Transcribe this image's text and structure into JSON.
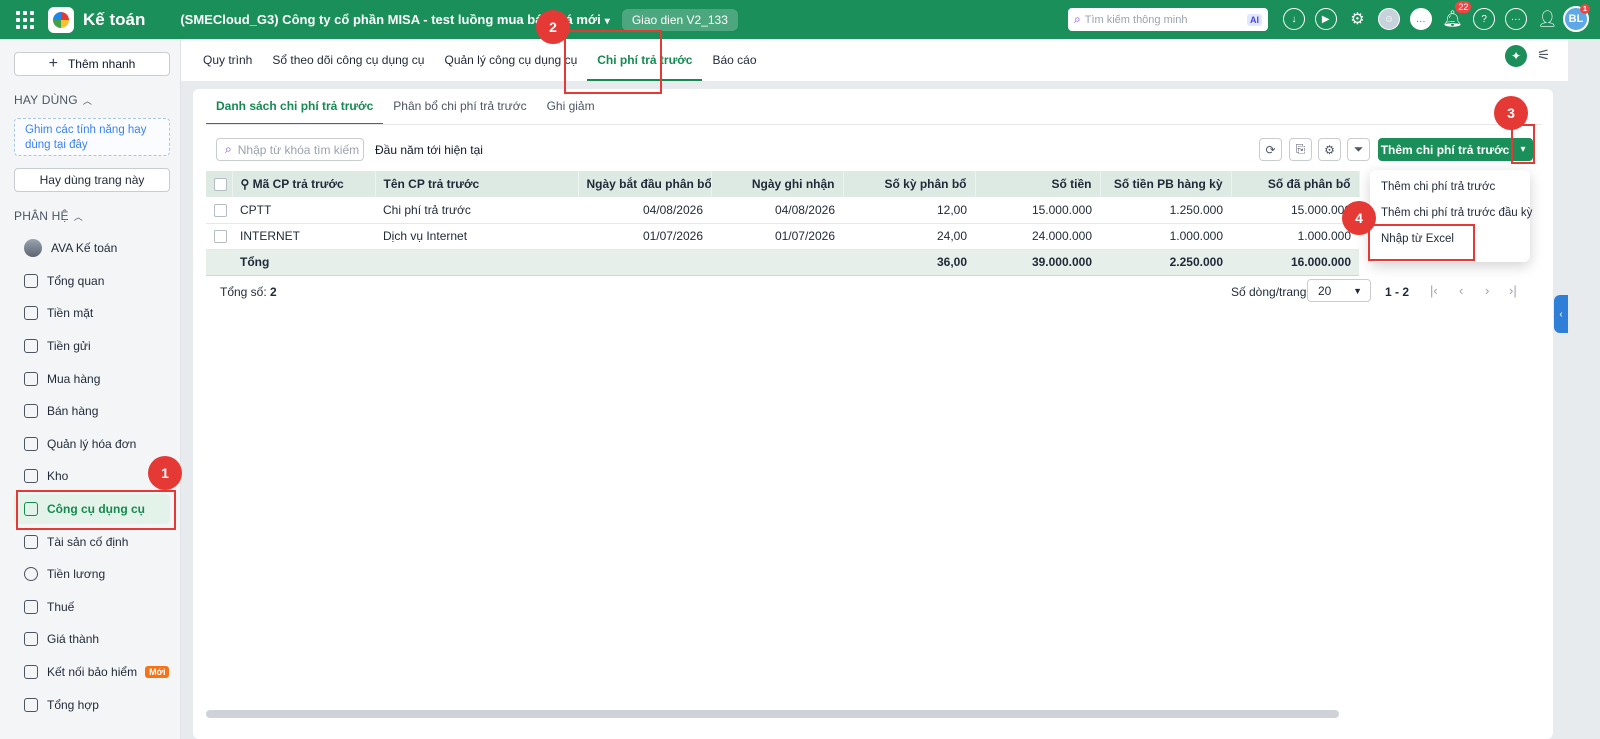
{
  "topbar": {
    "app_name": "Kế toán",
    "company": "(SMECloud_G3) Công ty cổ phần MISA - test luồng mua báo giá mới",
    "version": "Giao dien V2_133",
    "search_placeholder": "Tìm kiếm thông minh",
    "ai_label": "AI",
    "notification_count": "22",
    "user_initials": "BL",
    "user_badge": "1"
  },
  "sidebar": {
    "quick_add": "Thêm nhanh",
    "favorites_title": "HAY DÙNG",
    "pin_hint": "Ghim các tính năng hay dùng tại đây",
    "use_page_button": "Hay dùng trang này",
    "modules_title": "PHÂN HỆ",
    "items": [
      {
        "label": "AVA Kế toán"
      },
      {
        "label": "Tổng quan"
      },
      {
        "label": "Tiền mặt"
      },
      {
        "label": "Tiền gửi"
      },
      {
        "label": "Mua hàng"
      },
      {
        "label": "Bán hàng"
      },
      {
        "label": "Quản lý hóa đơn"
      },
      {
        "label": "Kho"
      },
      {
        "label": "Công cụ dụng cụ"
      },
      {
        "label": "Tài sản cố định"
      },
      {
        "label": "Tiền lương"
      },
      {
        "label": "Thuế"
      },
      {
        "label": "Giá thành"
      },
      {
        "label": "Kết nối bảo hiểm",
        "badge": "Mới"
      },
      {
        "label": "Tổng hợp"
      }
    ]
  },
  "main_tabs": [
    "Quy trình",
    "Sổ theo dõi công cụ dụng cụ",
    "Quản lý công cụ dụng cụ",
    "Chi phí trả trước",
    "Báo cáo"
  ],
  "sub_tabs": [
    "Danh sách chi phí trả trước",
    "Phân bổ chi phí trả trước",
    "Ghi giảm"
  ],
  "toolbar": {
    "search_placeholder": "Nhập từ khóa tìm kiếm",
    "period": "Đầu năm tới hiện tại",
    "primary_button": "Thêm chi phí trả trước"
  },
  "table": {
    "headers": [
      "Mã CP trả trước",
      "Tên CP trả trước",
      "Ngày bắt đầu phân bổ",
      "Ngày ghi nhận",
      "Số kỳ phân bổ",
      "Số tiền",
      "Số tiền PB hàng kỳ",
      "Số đã phân bổ"
    ],
    "rows": [
      [
        "CPTT",
        "Chi phí trả trước",
        "04/08/2026",
        "04/08/2026",
        "12,00",
        "15.000.000",
        "1.250.000",
        "15.000.000"
      ],
      [
        "INTERNET",
        "Dịch vụ Internet",
        "01/07/2026",
        "01/07/2026",
        "24,00",
        "24.000.000",
        "1.000.000",
        "1.000.000"
      ]
    ],
    "total_label": "Tổng",
    "totals": [
      "36,00",
      "39.000.000",
      "2.250.000",
      "16.000.000"
    ]
  },
  "pagination": {
    "total_label": "Tổng số:",
    "total_value": "2",
    "rows_per_page_label": "Số dòng/trang",
    "rows_per_page": "20",
    "range": "1 - 2"
  },
  "dropdown_menu": [
    "Thêm chi phí trả trước",
    "Thêm chi phí trả trước đầu kỳ",
    "Nhập từ Excel"
  ],
  "annotations": [
    "1",
    "2",
    "3",
    "4"
  ],
  "colors": {
    "brand": "#1b8f5a",
    "highlight": "#e53935"
  }
}
